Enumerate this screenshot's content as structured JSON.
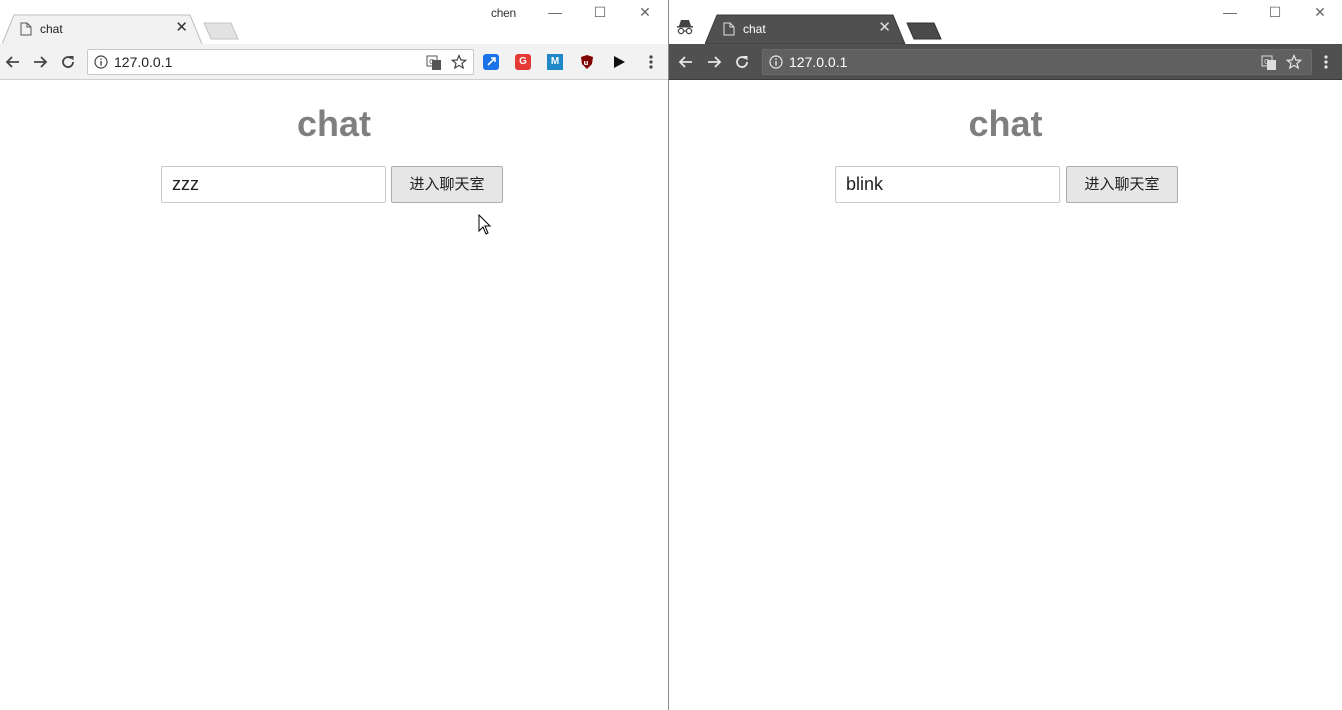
{
  "left_window": {
    "tab_title": "chat",
    "profile_name": "chen",
    "url": "127.0.0.1",
    "page": {
      "title": "chat",
      "input_value": "zzz",
      "button_label": "进入聊天室"
    },
    "extensions": [
      {
        "icon": "blue-extension-icon",
        "color": "#1a73e8",
        "glyph": ""
      },
      {
        "icon": "red-extension-icon",
        "color": "#e53935",
        "glyph": "G"
      },
      {
        "icon": "m-extension-icon",
        "color": "#1e88c8",
        "glyph": "M"
      },
      {
        "icon": "ublock-origin-icon",
        "color": "#800000",
        "glyph": ""
      },
      {
        "icon": "play-extension-icon",
        "color": "#111111",
        "glyph": ""
      }
    ]
  },
  "right_window": {
    "mode": "incognito",
    "tab_title": "chat",
    "url": "127.0.0.1",
    "page": {
      "title": "chat",
      "input_value": "blink",
      "button_label": "进入聊天室"
    }
  },
  "colors": {
    "title_text": "#7f7f7f",
    "incognito_toolbar": "#505050",
    "normal_toolbar": "#f2f2f2"
  }
}
